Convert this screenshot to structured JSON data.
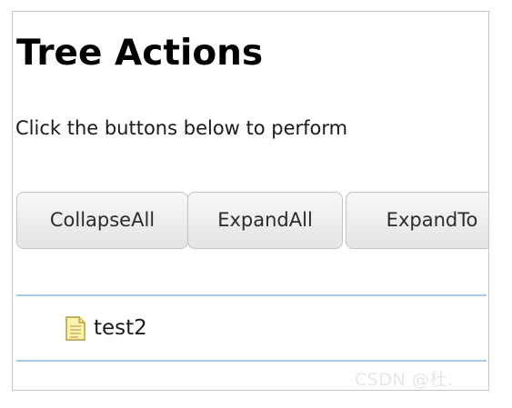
{
  "page": {
    "title": "Tree Actions",
    "description": "Click the buttons below to perform"
  },
  "toolbar": {
    "buttons": [
      {
        "label": "CollapseAll"
      },
      {
        "label": "ExpandAll"
      },
      {
        "label": "ExpandTo"
      }
    ]
  },
  "tree": {
    "nodes": [
      {
        "label": "test2",
        "icon": "file-icon"
      }
    ],
    "border_color": "#a7c6e8"
  },
  "watermark": {
    "text": "CSDN @杜."
  }
}
